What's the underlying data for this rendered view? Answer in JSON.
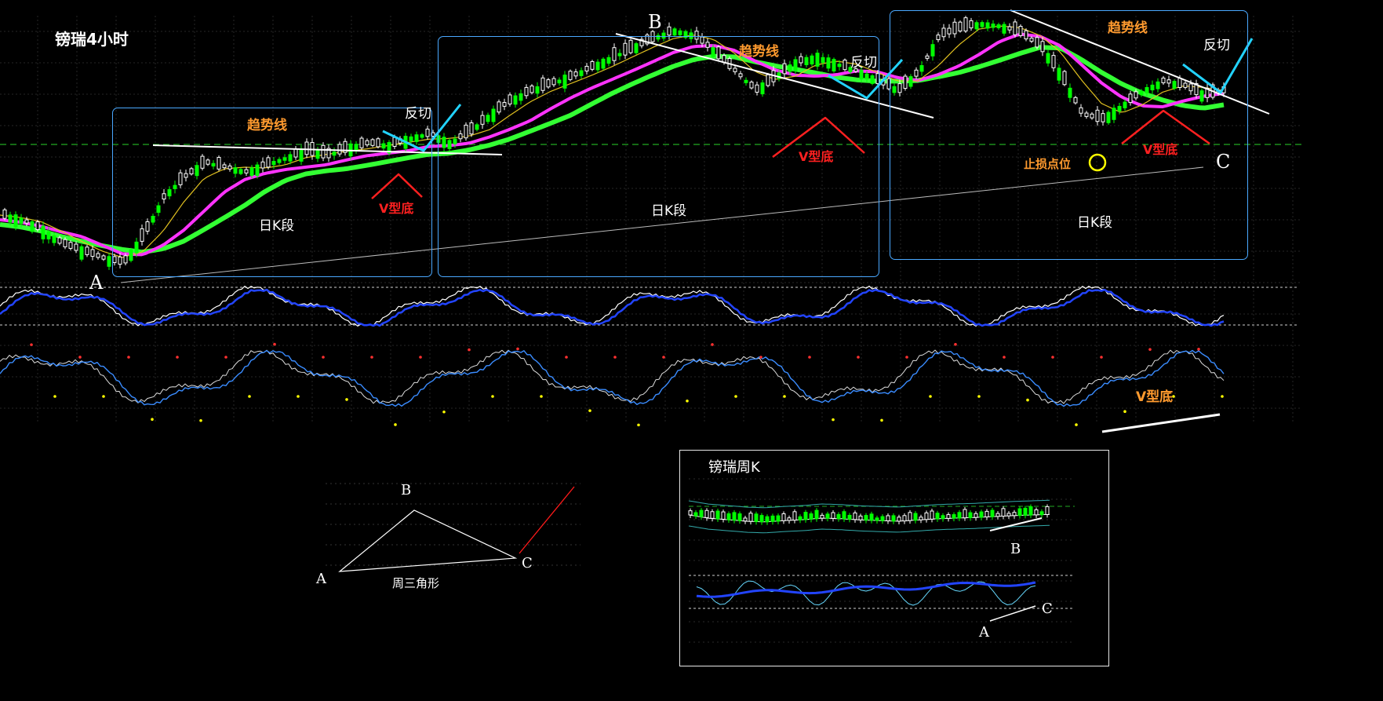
{
  "title": "镑瑞4小时",
  "labels": {
    "trendline": "趋势线",
    "reverse_cut": "反切",
    "v_bottom": "V型底",
    "daily_k_segment": "日K段",
    "stop_loss": "止损点位",
    "point_a": "A",
    "point_b": "B",
    "point_c": "C"
  },
  "triangle": {
    "caption": "周三角形",
    "a": "A",
    "b": "B",
    "c": "C"
  },
  "weekly_inset": {
    "title": "镑瑞周K",
    "a": "A",
    "b": "B",
    "c": "C"
  },
  "colors": {
    "background": "#000000",
    "candle_up": "#ffffff",
    "candle_down": "#00ff00",
    "ma_green": "#33ff33",
    "ma_magenta": "#ff33ff",
    "ma_yellow": "#e0c020",
    "box": "#4aa8ff",
    "cyan_line": "#22d3ff",
    "trend_white": "#ffffff",
    "v_red": "#ff2020",
    "text_orange": "#ff9a2e",
    "stop_circle": "#ffff00",
    "osc_blue": "#2244ff",
    "osc_white": "#ffffff",
    "osc_lightblue": "#3a8cff"
  },
  "chart_data": [
    {
      "type": "line",
      "title": "镑瑞4小时",
      "series": [
        {
          "values": [
            0.2,
            0.18,
            0.14,
            0.08,
            0.05,
            0.02,
            0.0,
            0.12,
            0.28,
            0.36,
            0.42,
            0.4,
            0.38,
            0.41,
            0.44,
            0.47,
            0.45,
            0.48,
            0.5,
            0.49,
            0.52,
            0.54,
            0.5,
            0.55,
            0.62,
            0.68,
            0.72,
            0.75,
            0.78,
            0.82,
            0.86,
            0.9,
            0.94,
            0.97,
            0.95,
            0.88,
            0.8,
            0.72,
            0.78,
            0.84,
            0.86,
            0.83,
            0.8,
            0.76,
            0.72,
            0.8,
            0.95,
            0.98,
            1.0,
            0.99,
            0.96,
            0.9,
            0.78,
            0.62,
            0.6,
            0.66,
            0.72,
            0.76,
            0.74,
            0.7,
            0.72
          ]
        }
      ]
    },
    {
      "type": "line",
      "title": "镑瑞周K",
      "series": [
        {
          "values": [
            0.6,
            0.5,
            0.45,
            0.4,
            0.38,
            0.42,
            0.45,
            0.5,
            0.48,
            0.44,
            0.42,
            0.4,
            0.44,
            0.48,
            0.5,
            0.52,
            0.55,
            0.58,
            0.6,
            0.62
          ]
        }
      ]
    }
  ]
}
